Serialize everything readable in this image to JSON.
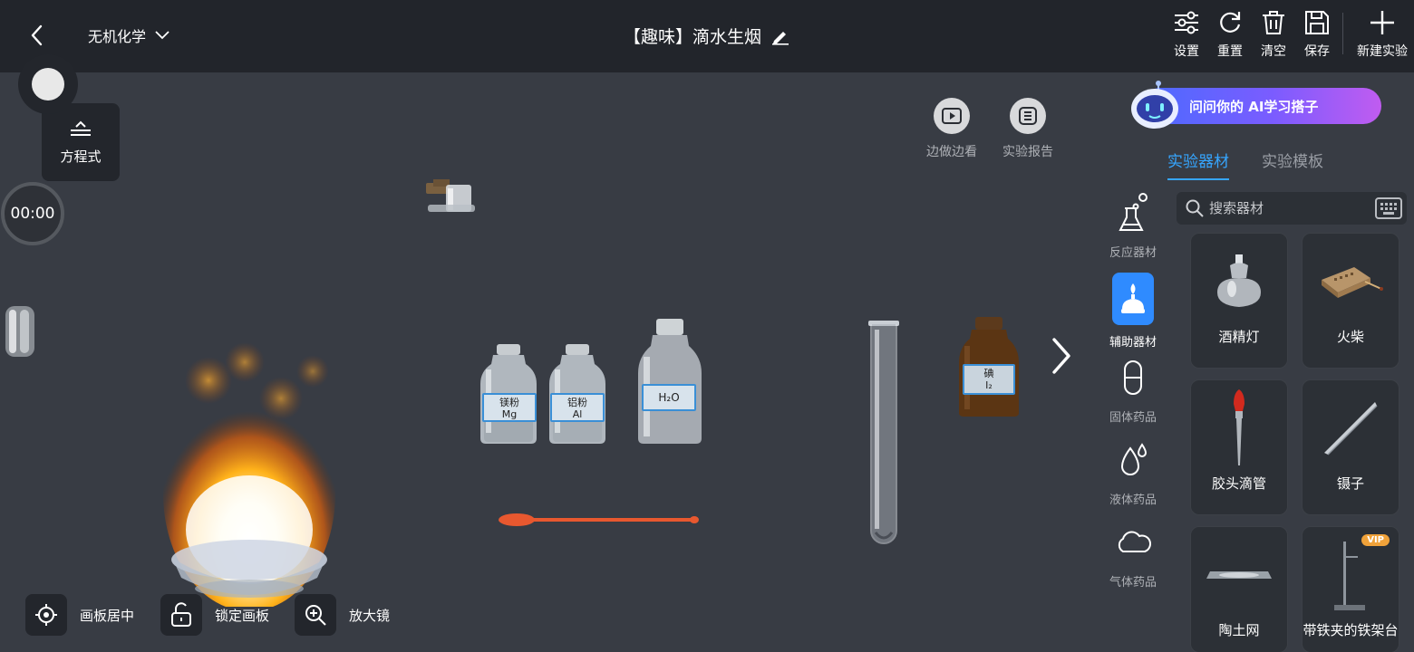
{
  "header": {
    "category": "无机化学",
    "title": "【趣味】滴水生烟",
    "tools": [
      {
        "label": "设置",
        "icon": "sliders-icon"
      },
      {
        "label": "重置",
        "icon": "refresh-icon"
      },
      {
        "label": "清空",
        "icon": "trash-icon"
      },
      {
        "label": "保存",
        "icon": "save-icon"
      }
    ],
    "new_label": "新建实验"
  },
  "left": {
    "equation_label": "方程式",
    "timer": "00:00"
  },
  "float_buttons": {
    "watch_label": "边做边看",
    "report_label": "实验报告"
  },
  "ai_banner": {
    "text": "问问你的 AI学习搭子"
  },
  "panel": {
    "tabs": [
      {
        "label": "实验器材",
        "active": true
      },
      {
        "label": "实验模板",
        "active": false
      }
    ],
    "categories": [
      {
        "label": "反应器材",
        "icon": "flask-icon"
      },
      {
        "label": "辅助器材",
        "icon": "burner-icon",
        "active": true
      },
      {
        "label": "固体药品",
        "icon": "capsule-icon"
      },
      {
        "label": "液体药品",
        "icon": "droplet-icon"
      },
      {
        "label": "气体药品",
        "icon": "cloud-icon"
      }
    ],
    "search_placeholder": "搜索器材",
    "items": [
      {
        "label": "酒精灯",
        "icon": "alcohol-lamp-icon"
      },
      {
        "label": "火柴",
        "icon": "matchbox-icon"
      },
      {
        "label": "胶头滴管",
        "icon": "dropper-icon"
      },
      {
        "label": "镊子",
        "icon": "tweezers-icon"
      },
      {
        "label": "陶土网",
        "icon": "ceramic-mesh-icon"
      },
      {
        "label": "带铁夹的铁架台",
        "icon": "iron-stand-icon",
        "badge": "VIP"
      }
    ]
  },
  "canvas": {
    "bottles": [
      {
        "line1": "镁粉",
        "line2": "Mg"
      },
      {
        "line1": "铝粉",
        "line2": "Al"
      },
      {
        "line1": "H₂O",
        "line2": ""
      },
      {
        "line1": "碘",
        "line2": "I₂"
      }
    ]
  },
  "bottom": {
    "center_label": "画板居中",
    "lock_label": "锁定画板",
    "magnifier_label": "放大镜"
  }
}
